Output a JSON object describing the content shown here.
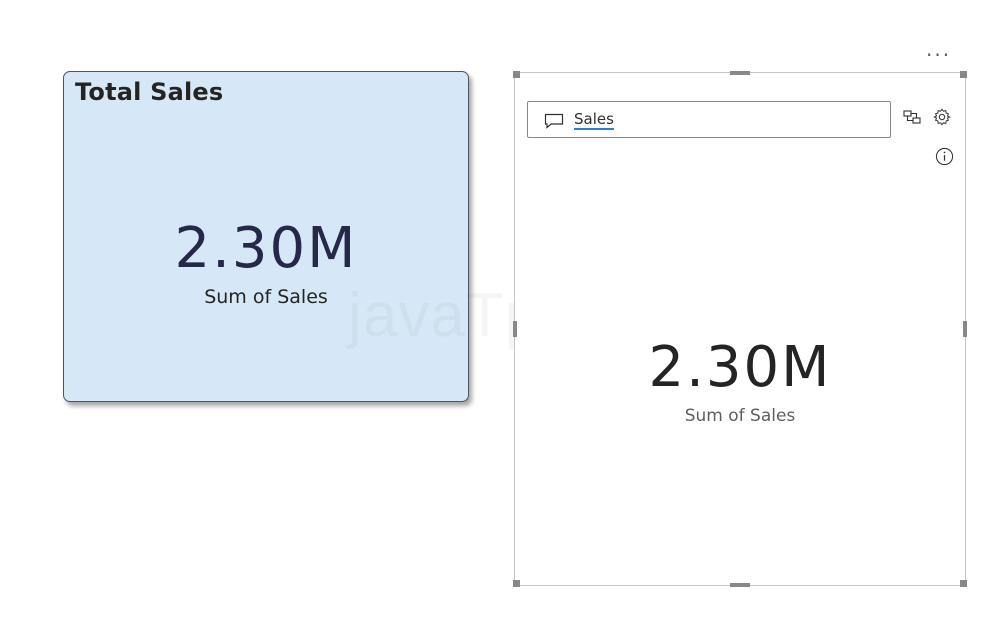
{
  "left_card": {
    "title": "Total Sales",
    "value": "2.30M",
    "label": "Sum of Sales"
  },
  "watermark": "javaTpoint",
  "right_visual": {
    "more_options": "...",
    "qna_input": "Sales",
    "value": "2.30M",
    "label": "Sum of Sales"
  },
  "colors": {
    "card_background": "#d6e8f7",
    "value_dark_navy": "#252848",
    "underline_blue": "#2f7fd1"
  }
}
